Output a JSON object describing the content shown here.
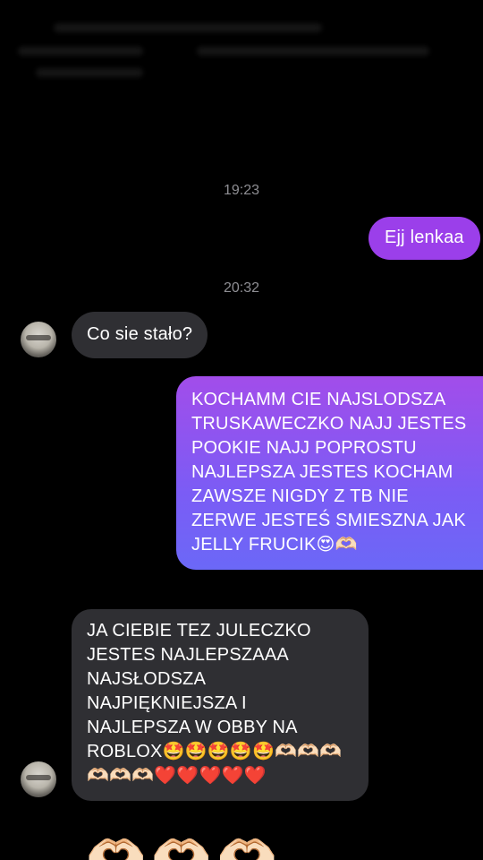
{
  "timestamps": [
    "19:23",
    "20:32"
  ],
  "messages": [
    {
      "direction": "sent",
      "text": "Ejj lenkaa"
    },
    {
      "direction": "received",
      "text": "Co sie stało?"
    },
    {
      "direction": "sent",
      "text": "KOCHAMM CIE NAJSLODSZA TRUSKAWECZKO NAJJ JESTES POOKIE NAJJ POPROSTU NAJLEPSZA JESTES KOCHAM ZAWSZE NIGDY Z TB NIE ZERWE JESTEŚ SMIESZNA JAK JELLY FRUCIK😍🫶🏻"
    },
    {
      "direction": "received",
      "text": "JA CIEBIE TEZ JULECZKO JESTES NAJLEPSZAAA NAJSŁODSZA NAJPIĘKNIEJSZA I NAJLEPSZA W OBBY NA ROBLOX🤩🤩🤩🤩🤩🫶🏻🫶🏻🫶🏻🫶🏻🫶🏻🫶🏻❤️❤️❤️❤️❤️"
    },
    {
      "direction": "received",
      "text": "🫶🏻🫶🏻🫶🏻"
    }
  ],
  "colors": {
    "background": "#000000",
    "sent_bubble": "#9b3fea",
    "received_bubble": "#2f2f33",
    "timestamp": "#8e8e93"
  }
}
